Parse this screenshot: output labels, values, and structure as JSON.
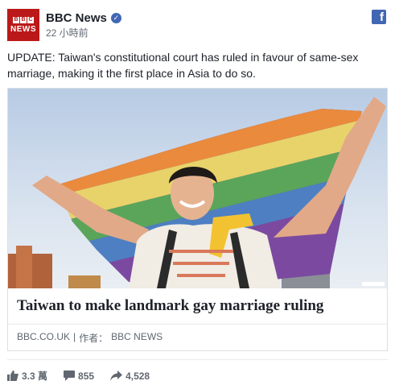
{
  "header": {
    "logo_letters": [
      "B",
      "B",
      "C"
    ],
    "logo_word": "NEWS",
    "page_name": "BBC News",
    "verified_mark": "✓",
    "timestamp": "22 小時前",
    "platform_icon": "f"
  },
  "post": {
    "text": "UPDATE: Taiwan's constitutional court has ruled in favour of same-sex marriage, making it the first place in Asia to do so."
  },
  "card": {
    "image_icon": "rainbow-flag-photo",
    "title": "Taiwan to make landmark gay marriage ruling",
    "domain": "BBC.CO.UK",
    "separator": "|",
    "author_label": "作者：",
    "author": "BBC NEWS"
  },
  "footer": {
    "likes": "3.3 萬",
    "comments": "855",
    "shares": "4,528"
  },
  "colors": {
    "bbc_red": "#bb1919",
    "facebook_blue": "#4267b2",
    "text": "#1d2129",
    "muted": "#606770"
  }
}
